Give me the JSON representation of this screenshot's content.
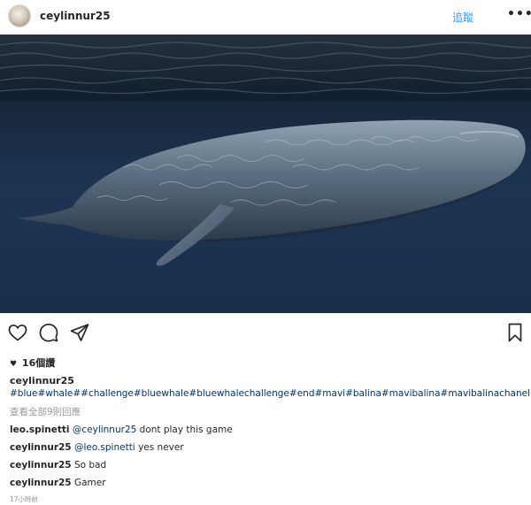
{
  "header": {
    "username": "ceylinnur25",
    "follow_label": "追蹤",
    "more_label": "•••"
  },
  "photo": {
    "subject": "blue whale underwater",
    "colors": {
      "water_dark": "#0b1524",
      "water_mid": "#1f3550",
      "whale": "#5d7286"
    }
  },
  "actions": {
    "icons": [
      "heart-icon",
      "comment-icon",
      "share-icon",
      "bookmark-icon"
    ]
  },
  "likes": {
    "label": "16個讚"
  },
  "caption": {
    "username": "ceylinnur25",
    "hashtags": "#blue#whale##challenge#bluewhale#bluewhalechallenge#end#mavi#balina#mavibalina#mavibalinachanell#son"
  },
  "view_all": "查看全部9則回應",
  "comments": [
    {
      "user": "leo.spinetti",
      "mention": "@ceylinnur25",
      "text": " dont play this game"
    },
    {
      "user": "ceylinnur25",
      "mention": "@leo.spinetti",
      "text": " yes never"
    },
    {
      "user": "ceylinnur25",
      "mention": "",
      "text": " So bad"
    },
    {
      "user": "ceylinnur25",
      "mention": "",
      "text": " Gamer"
    }
  ],
  "timestamp": "17小時前"
}
